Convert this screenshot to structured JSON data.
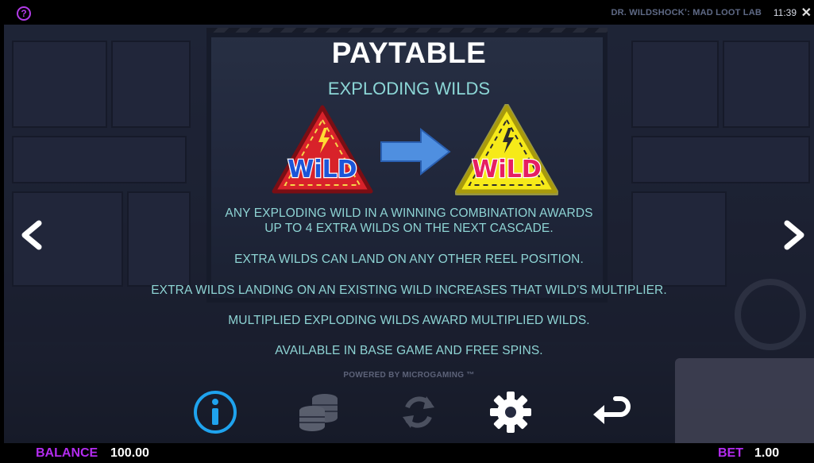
{
  "top_bar": {
    "help_symbol": "?",
    "game_title": "DR. WILDSHOCKʼ: MAD LOOT LAB",
    "clock": "11:39",
    "close_symbol": "✕"
  },
  "paytable": {
    "title": "PAYTABLE",
    "subtitle": "EXPLODING WILDS",
    "wild_before_label": "WiLD",
    "wild_after_label": "WiLD",
    "paragraphs": [
      "ANY EXPLODING WILD IN A WINNING COMBINATION AWARDS",
      "UP TO 4 EXTRA WILDS ON THE NEXT CASCADE.",
      "EXTRA WILDS CAN LAND ON ANY OTHER REEL POSITION.",
      "EXTRA WILDS LANDING ON AN EXISTING WILD INCREASES THAT WILD’S MULTIPLIER.",
      "MULTIPLIED EXPLODING WILDS AWARD MULTIPLIED WILDS.",
      "AVAILABLE IN BASE GAME AND FREE SPINS."
    ],
    "powered_by": "POWERED BY MICROGAMING ™"
  },
  "icons": {
    "prev": "chevron-left-icon",
    "next": "chevron-right-icon",
    "info": "info-icon",
    "coins": "coins-icon",
    "autoplay": "autoplay-icon",
    "settings": "gear-icon",
    "back": "return-arrow-icon"
  },
  "colors": {
    "accent_purple": "#b32cf0",
    "text_teal": "#8ed4d4",
    "info_blue": "#1fa3ee"
  },
  "bottom_bar": {
    "balance_label": "BALANCE",
    "balance_value": "100.00",
    "bet_label": "BET",
    "bet_value": "1.00"
  }
}
